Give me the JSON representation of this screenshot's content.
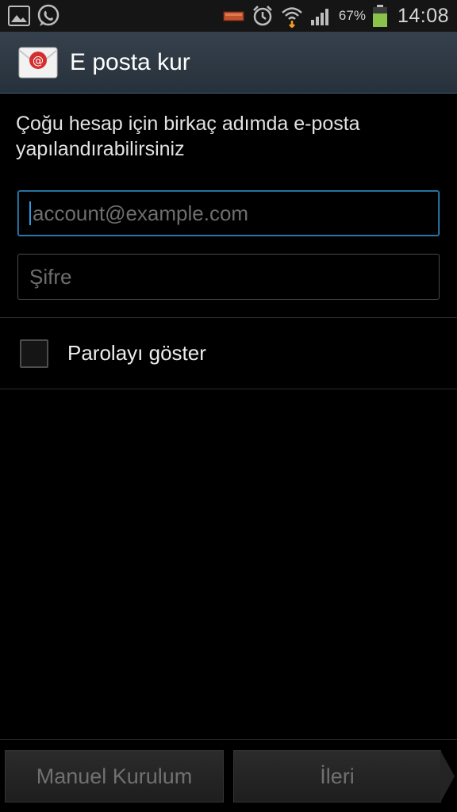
{
  "status_bar": {
    "battery_percent": "67%",
    "time": "14:08",
    "icons": [
      "gallery-icon",
      "whatsapp-icon",
      "battery-saver-icon",
      "alarm-icon",
      "wifi-icon",
      "signal-icon",
      "battery-icon"
    ]
  },
  "header": {
    "title": "E posta kur",
    "icon": "email-app-icon"
  },
  "form": {
    "intro": "Çoğu hesap için birkaç adımda e-posta yapılandırabilirsiniz",
    "email": {
      "placeholder": "account@example.com",
      "value": ""
    },
    "password": {
      "placeholder": "Şifre",
      "value": ""
    },
    "show_password_label": "Parolayı göster",
    "show_password_checked": false
  },
  "footer": {
    "manual_label": "Manuel Kurulum",
    "next_label": "İleri"
  },
  "colors": {
    "accent": "#2e8fc9",
    "header_bg": "#2f3944",
    "battery": "#8bc34a"
  }
}
